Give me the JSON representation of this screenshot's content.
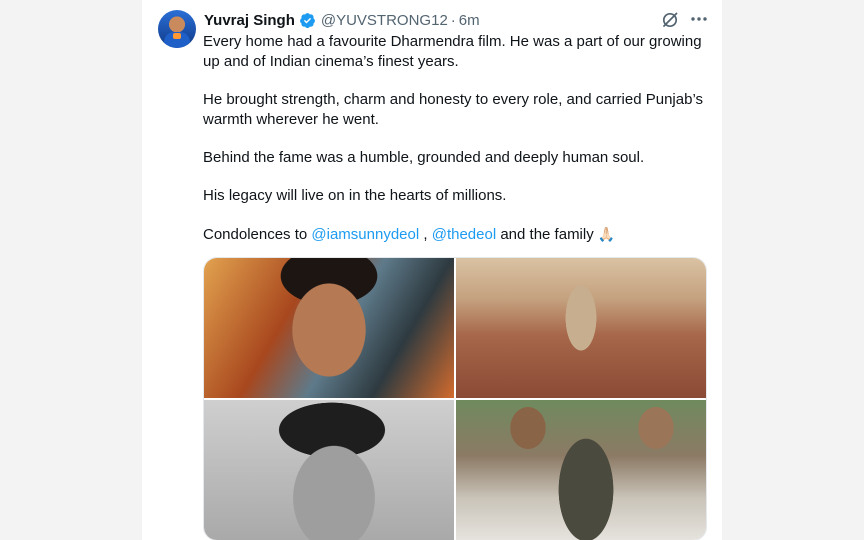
{
  "post": {
    "author_name": "Yuvraj Singh",
    "handle": "@YUVSTRONG12",
    "separator": "·",
    "time": "6m",
    "text": {
      "p1": "Every home had a favourite Dharmendra film. He was a part of our growing up and of Indian cinema’s finest years.",
      "p2": "He brought strength, charm and honesty to every role, and carried Punjab’s warmth wherever he went.",
      "p3": "Behind the fame was a humble, grounded and deeply human soul.",
      "p4": "His legacy will live on in the hearts of millions.",
      "p5_prefix": "Condolences to ",
      "mention1": "@iamsunnydeol",
      "p5_sep": " , ",
      "mention2": "@thedeol",
      "p5_suffix": " and the family ",
      "emoji": "🙏🏻"
    }
  },
  "icons": {
    "verified": "verified-badge-icon",
    "grok": "grok-icon",
    "more": "more-icon"
  },
  "colors": {
    "link": "#1d9bf0",
    "verified": "#1d9bf0",
    "text": "#0f1419",
    "muted": "#536471"
  }
}
